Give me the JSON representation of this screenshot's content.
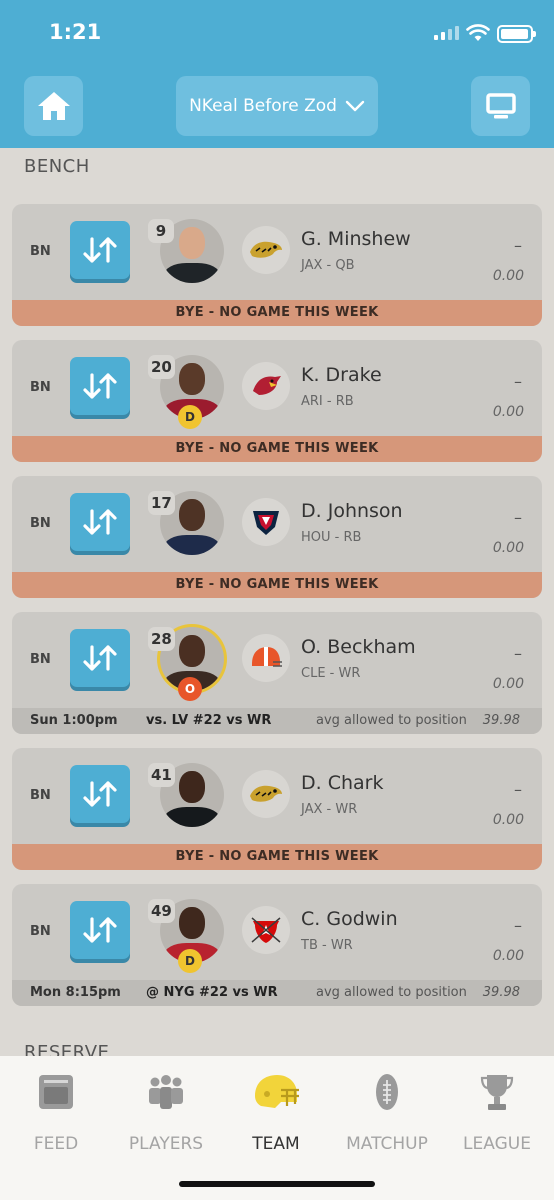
{
  "status_bar": {
    "time": "1:21"
  },
  "header": {
    "team_name": "NKeal Before Zod"
  },
  "sections": {
    "bench": "BENCH",
    "reserve": "RESERVE"
  },
  "players": [
    {
      "slot": "BN",
      "number": "9",
      "name": "G. Minshew",
      "team_pos": "JAX - QB",
      "proj": "–",
      "points": "0.00",
      "bye": "BYE - NO GAME THIS WEEK"
    },
    {
      "slot": "BN",
      "number": "20",
      "status": "D",
      "name": "K. Drake",
      "team_pos": "ARI - RB",
      "proj": "–",
      "points": "0.00",
      "bye": "BYE - NO GAME THIS WEEK"
    },
    {
      "slot": "BN",
      "number": "17",
      "name": "D. Johnson",
      "team_pos": "HOU - RB",
      "proj": "–",
      "points": "0.00",
      "bye": "BYE - NO GAME THIS WEEK"
    },
    {
      "slot": "BN",
      "number": "28",
      "status": "O",
      "name": "O. Beckham",
      "team_pos": "CLE - WR",
      "proj": "–",
      "points": "0.00",
      "game_time": "Sun 1:00pm",
      "matchup": "vs. LV #22 vs WR",
      "avg_label": "avg allowed to position",
      "avg_value": "39.98"
    },
    {
      "slot": "BN",
      "number": "41",
      "name": "D. Chark",
      "team_pos": "JAX - WR",
      "proj": "–",
      "points": "0.00",
      "bye": "BYE - NO GAME THIS WEEK"
    },
    {
      "slot": "BN",
      "number": "49",
      "status": "D",
      "name": "C. Godwin",
      "team_pos": "TB - WR",
      "proj": "–",
      "points": "0.00",
      "game_time": "Mon 8:15pm",
      "matchup": "@ NYG #22 vs WR",
      "avg_label": "avg allowed to position",
      "avg_value": "39.98"
    }
  ],
  "tabs": [
    {
      "label": "FEED",
      "icon": "feed-icon"
    },
    {
      "label": "PLAYERS",
      "icon": "players-icon"
    },
    {
      "label": "TEAM",
      "icon": "helmet-icon",
      "active": true
    },
    {
      "label": "MATCHUP",
      "icon": "football-icon"
    },
    {
      "label": "LEAGUE",
      "icon": "trophy-icon"
    }
  ],
  "colors": {
    "header": "#4eaed3",
    "bye_bar": "#d6977a",
    "status_d": "#f0c42f",
    "status_o": "#e8562a",
    "active_tab_helmet": "#f2d43a"
  }
}
